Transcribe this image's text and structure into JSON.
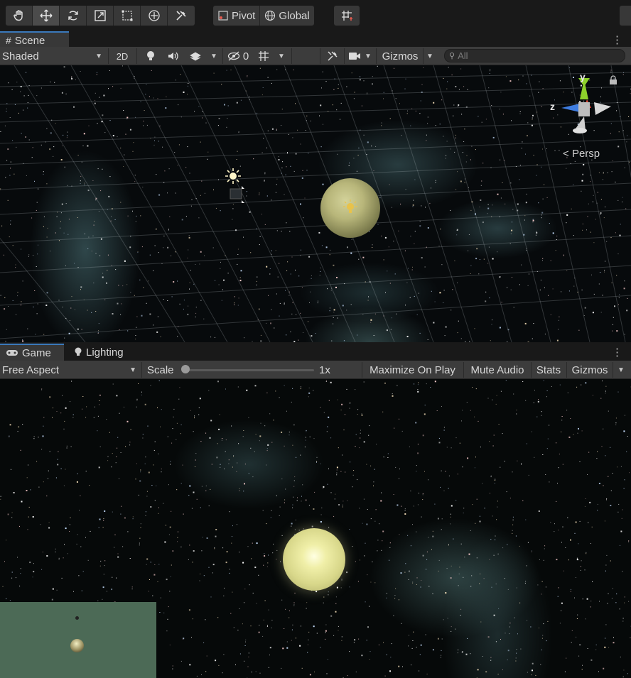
{
  "toolbar": {
    "tools": [
      "hand-tool",
      "move-tool",
      "rotate-tool",
      "scale-tool",
      "rect-tool",
      "transform-tool",
      "custom-tool"
    ],
    "active_tool": "move-tool",
    "pivot_label": "Pivot",
    "global_label": "Global"
  },
  "scene_tab": {
    "label": "Scene"
  },
  "scene_toolbar": {
    "draw_mode": "Shaded",
    "mode_2d": "2D",
    "hidden_count": "0",
    "gizmos_label": "Gizmos",
    "search_placeholder": "All"
  },
  "scene_view": {
    "gizmo_axes": {
      "y": "y",
      "z": "z"
    },
    "projection_label": "Persp"
  },
  "game_tabs": {
    "game_label": "Game",
    "lighting_label": "Lighting"
  },
  "game_toolbar": {
    "aspect": "Free Aspect",
    "scale_label": "Scale",
    "scale_value": "1x",
    "scale_fraction": 0.0,
    "maximize_label": "Maximize On Play",
    "mute_label": "Mute Audio",
    "stats_label": "Stats",
    "gizmos_label": "Gizmos"
  },
  "colors": {
    "sun": "#f0efa8",
    "accent": "#3a79bb",
    "minimap": "#4c6a56"
  }
}
